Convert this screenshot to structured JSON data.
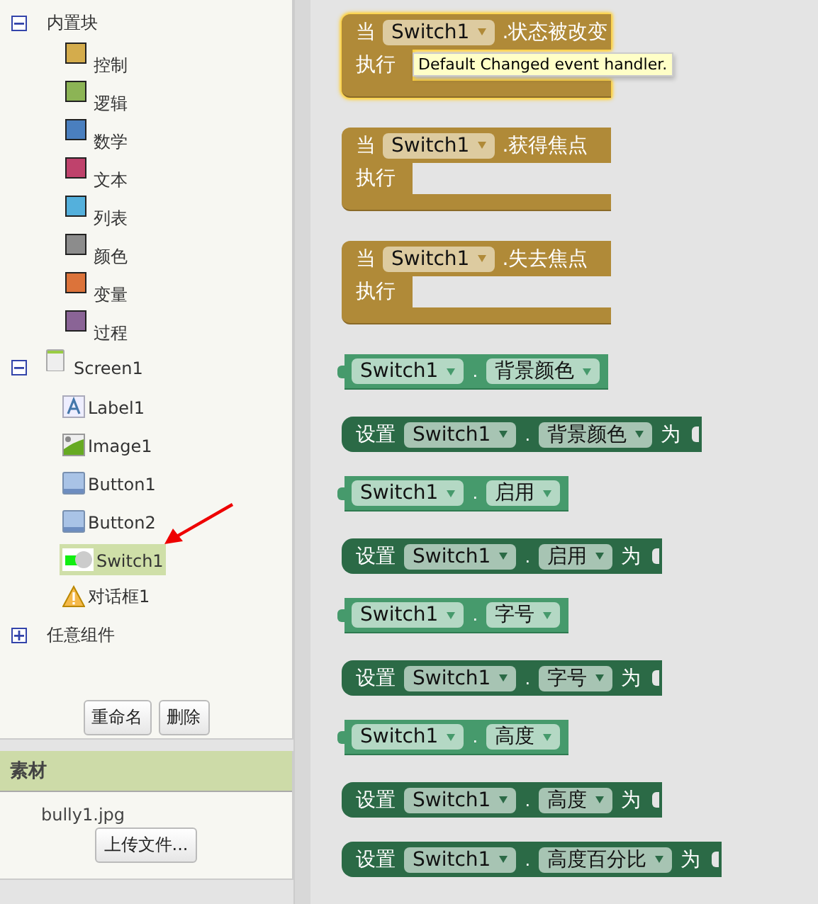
{
  "tree": [
    {
      "label": "内置块",
      "expanded": true,
      "children": [
        {
          "label": "控制",
          "color": "#d4ac4c"
        },
        {
          "label": "逻辑",
          "color": "#8cb455"
        },
        {
          "label": "数学",
          "color": "#4a7fbf"
        },
        {
          "label": "文本",
          "color": "#bf426c"
        },
        {
          "label": "列表",
          "color": "#54b0dc"
        },
        {
          "label": "颜色",
          "color": "#8c8c8c"
        },
        {
          "label": "变量",
          "color": "#dc733a"
        },
        {
          "label": "过程",
          "color": "#8a6496"
        }
      ]
    },
    {
      "label": "Screen1",
      "expanded": true,
      "kind": "screen",
      "children": [
        {
          "label": "Label1",
          "kind": "label",
          "selected": false
        },
        {
          "label": "Image1",
          "kind": "image",
          "selected": false
        },
        {
          "label": "Button1",
          "kind": "button",
          "selected": false
        },
        {
          "label": "Button2",
          "kind": "button",
          "selected": false
        },
        {
          "label": "Switch1",
          "kind": "switch",
          "selected": true
        },
        {
          "label": "对话框1",
          "kind": "notifier",
          "selected": false
        }
      ]
    },
    {
      "label": "任意组件",
      "expanded": false
    }
  ],
  "component_buttons": [
    "重命名",
    "删除"
  ],
  "assets": {
    "title": "素材",
    "files": [
      "bully1.jpg"
    ],
    "upload_button": "上传文件..."
  },
  "tooltip": "Default Changed event handler.",
  "blocks": [
    {
      "kind": "event",
      "keyword": "当",
      "component": "Switch1",
      "event": ".状态被改变",
      "do_label": "执行",
      "highlighted": true
    },
    {
      "kind": "event",
      "keyword": "当",
      "component": "Switch1",
      "event": ".获得焦点",
      "do_label": "执行",
      "highlighted": false
    },
    {
      "kind": "event",
      "keyword": "当",
      "component": "Switch1",
      "event": ".失去焦点",
      "do_label": "执行",
      "highlighted": false
    },
    {
      "kind": "getter",
      "component": "Switch1",
      "dot": ".",
      "property": "背景颜色"
    },
    {
      "kind": "setter",
      "keyword": "设置",
      "component": "Switch1",
      "dot": ".",
      "property": "背景颜色",
      "to": "为"
    },
    {
      "kind": "getter",
      "component": "Switch1",
      "dot": ".",
      "property": "启用"
    },
    {
      "kind": "setter",
      "keyword": "设置",
      "component": "Switch1",
      "dot": ".",
      "property": "启用",
      "to": "为"
    },
    {
      "kind": "getter",
      "component": "Switch1",
      "dot": ".",
      "property": "字号"
    },
    {
      "kind": "setter",
      "keyword": "设置",
      "component": "Switch1",
      "dot": ".",
      "property": "字号",
      "to": "为"
    },
    {
      "kind": "getter",
      "component": "Switch1",
      "dot": ".",
      "property": "高度"
    },
    {
      "kind": "setter",
      "keyword": "设置",
      "component": "Switch1",
      "dot": ".",
      "property": "高度",
      "to": "为"
    },
    {
      "kind": "setter",
      "keyword": "设置",
      "component": "Switch1",
      "dot": ".",
      "property": "高度百分比",
      "to": "为"
    }
  ]
}
